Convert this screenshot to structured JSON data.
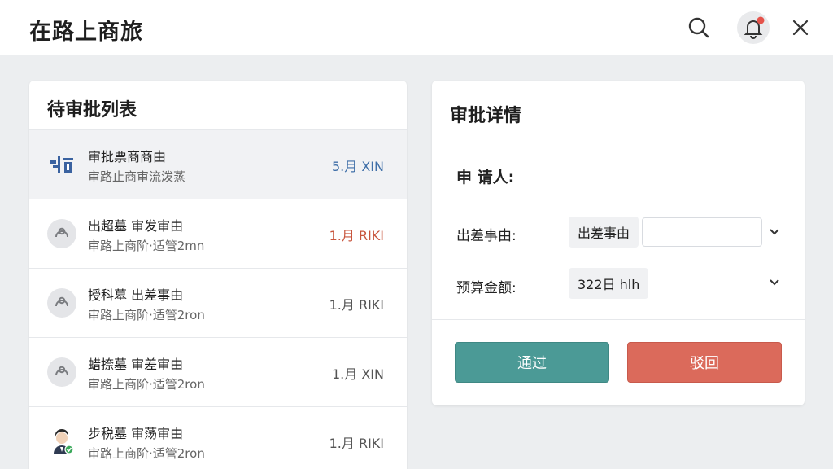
{
  "app": {
    "title": "在路上商旅"
  },
  "header_icons": [
    "search-icon",
    "bell-icon",
    "close-icon"
  ],
  "colors": {
    "accent_green": "#4b9a96",
    "accent_red": "#db6a5b",
    "notification_dot": "#e5534b",
    "blue_text": "#3f6fa8"
  },
  "pending": {
    "title": "待审批列表",
    "items": [
      {
        "title": "审批票商商由",
        "subtitle": "审路止商审流泼蒸",
        "meta": "5.月 XIN",
        "icon": "travel-icon"
      },
      {
        "title": "出超墓 审发审由",
        "subtitle": "审路上商阶·适管2mn",
        "meta": "1.月 RIKI",
        "icon": "user-icon"
      },
      {
        "title": "授科墓 出差事由",
        "subtitle": "审路上商阶·适管2ron",
        "meta": "1.月 RIKI",
        "icon": "user-icon"
      },
      {
        "title": "蜡捺墓 审差审由",
        "subtitle": "审路上商阶·适管2ron",
        "meta": "1.月 XIN",
        "icon": "user-icon"
      },
      {
        "title": "步税墓 审荡审由",
        "subtitle": "审路上商阶·适管2ron",
        "meta": "1.月 RIKI",
        "icon": "person-avatar"
      }
    ]
  },
  "detail": {
    "title": "审批详情",
    "applicant_label": "申  请人:",
    "reason_label": "出差事由:",
    "reason_tag": "出差事由",
    "reason_input_value": "",
    "budget_label": "预算金额:",
    "budget_value": "322日 hlh",
    "approve_label": "通过",
    "reject_label": "驳回"
  }
}
